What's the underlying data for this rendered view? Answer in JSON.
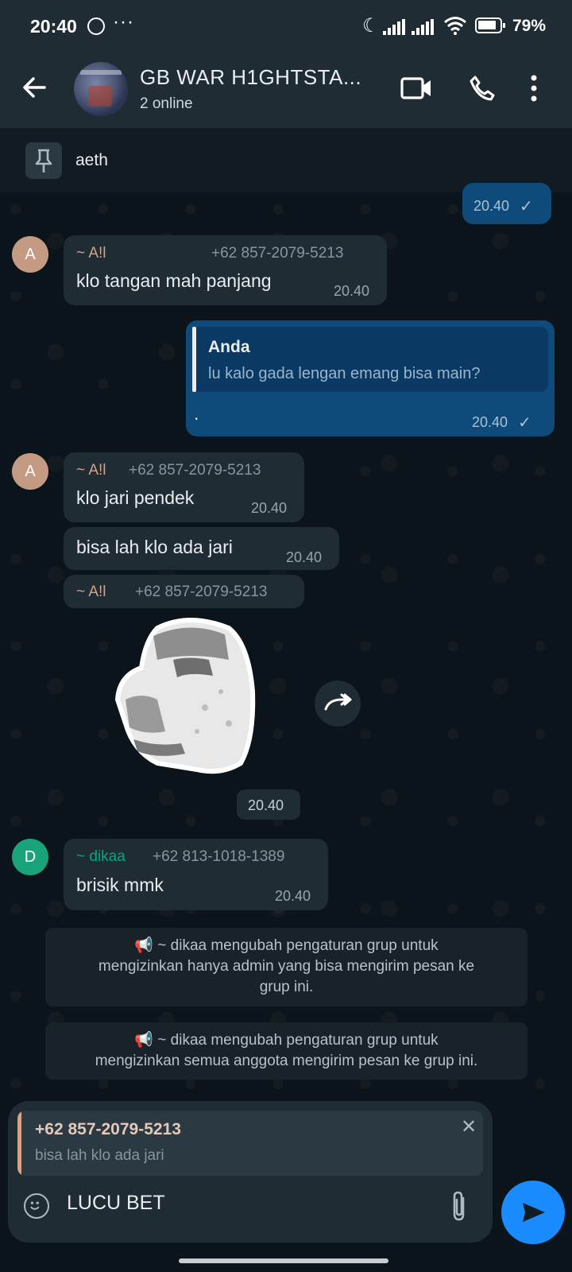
{
  "status_bar": {
    "time": "20:40",
    "more": "···",
    "battery_pct": "79%"
  },
  "header": {
    "title": "GB WAR H1GHTSTA...",
    "subtitle": "2 online"
  },
  "pinned": {
    "text": "aeth"
  },
  "messages": {
    "top_out_time": "20.40",
    "m1": {
      "sender": "~ A!l",
      "phone": "+62 857-2079-5213",
      "text": "klo tangan mah panjang",
      "time": "20.40",
      "avatar": "A"
    },
    "m2": {
      "quote_name": "Anda",
      "quote_text": "lu kalo gada lengan emang bisa main?",
      "text": ".",
      "time": "20.40"
    },
    "m3": {
      "sender": "~ A!l",
      "phone": "+62 857-2079-5213",
      "text": "klo jari pendek",
      "time": "20.40",
      "avatar": "A"
    },
    "m4": {
      "text": "bisa lah klo ada jari",
      "time": "20.40"
    },
    "m5": {
      "sender": "~ A!l",
      "phone": "+62 857-2079-5213",
      "time": "20.40"
    },
    "m6": {
      "sender": "~ dikaa",
      "phone": "+62 813-1018-1389",
      "text": "brisik mmk",
      "time": "20.40",
      "avatar": "D"
    },
    "sys1": {
      "line1": "📢 ~ dikaa mengubah pengaturan grup untuk",
      "line2": "mengizinkan hanya admin yang bisa mengirim pesan ke",
      "line3": "grup ini."
    },
    "sys2": {
      "line1": "📢 ~ dikaa mengubah pengaturan grup untuk",
      "line2": "mengizinkan semua anggota mengirim pesan ke grup ini."
    }
  },
  "composer": {
    "reply_name": "+62 857-2079-5213",
    "reply_text": "bisa lah klo ada jari",
    "input_value": "LUCU BET"
  },
  "colors": {
    "accent_blue": "#1a8cff",
    "outgoing_bubble": "#0e4a7a",
    "sender_a": "#d4a38a",
    "sender_d": "#00a884"
  }
}
